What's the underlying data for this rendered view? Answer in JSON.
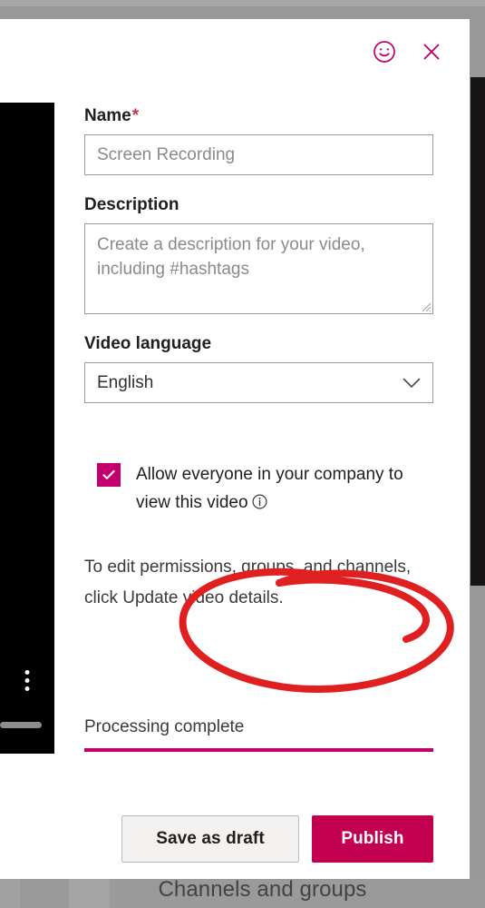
{
  "background": {
    "bottom_label": "Channels and groups"
  },
  "dialog": {
    "header": {
      "feedback_icon": "smiley-face-icon",
      "close_icon": "close-x-icon"
    },
    "name": {
      "label": "Name",
      "required_marker": "*",
      "value": "",
      "placeholder": "Screen Recording"
    },
    "description": {
      "label": "Description",
      "value": "",
      "placeholder": "Create a description for your video, including #hashtags"
    },
    "video_language": {
      "label": "Video language",
      "selected": "English",
      "options": [
        "English"
      ],
      "chevron_icon": "chevron-down-icon"
    },
    "permission": {
      "checked": true,
      "label": "Allow everyone in your company to view this video",
      "info_icon": "info-circle-icon"
    },
    "note": "To edit permissions, groups, and channels, click Update video details.",
    "progress": {
      "status": "Processing complete",
      "percent": 100
    },
    "actions": {
      "secondary_label": "Save as draft",
      "primary_label": "Publish"
    }
  },
  "left_panel": {
    "more_icon": "more-vertical-icon",
    "drag_handle": "drag-handle-bar"
  },
  "annotation": {
    "type": "hand-drawn-circle",
    "color": "#e02020"
  },
  "colors": {
    "accent": "#c3006b",
    "primary_button": "#c3004f",
    "required_star": "#c0354a",
    "annotation_red": "#e02020",
    "panel_black": "#000000",
    "background_gray": "#989898"
  }
}
